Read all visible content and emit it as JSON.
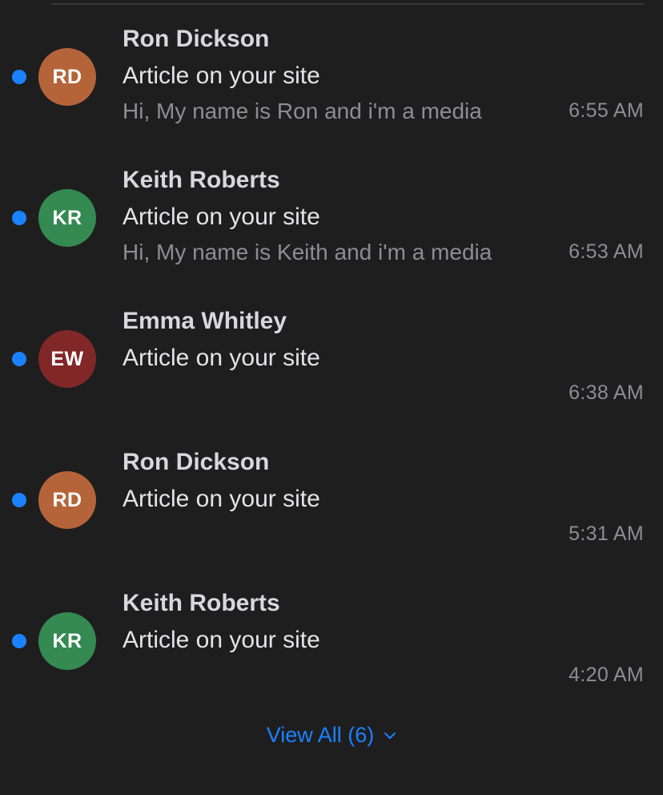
{
  "colors": {
    "accent": "#1a82ff",
    "avatar_rd": "#b5643a",
    "avatar_kr": "#348a51",
    "avatar_ew": "#822727"
  },
  "messages": [
    {
      "sender": "Ron Dickson",
      "initials": "RD",
      "avatar_color": "#b5643a",
      "subject": "Article on your site",
      "preview": "Hi, My name is Ron and i'm a media",
      "time": "6:55 AM",
      "unread": true
    },
    {
      "sender": "Keith Roberts",
      "initials": "KR",
      "avatar_color": "#348a51",
      "subject": "Article on your site",
      "preview": "Hi, My name is Keith and i'm a media",
      "time": "6:53 AM",
      "unread": true
    },
    {
      "sender": "Emma Whitley",
      "initials": "EW",
      "avatar_color": "#822727",
      "subject": "Article on your site",
      "preview": "",
      "time": "6:38 AM",
      "unread": true
    },
    {
      "sender": "Ron Dickson",
      "initials": "RD",
      "avatar_color": "#b5643a",
      "subject": "Article on your site",
      "preview": "",
      "time": "5:31 AM",
      "unread": true
    },
    {
      "sender": "Keith Roberts",
      "initials": "KR",
      "avatar_color": "#348a51",
      "subject": "Article on your site",
      "preview": "",
      "time": "4:20 AM",
      "unread": true
    }
  ],
  "footer": {
    "view_all_label": "View All (6)",
    "chevron_icon": "chevron-down-icon"
  }
}
